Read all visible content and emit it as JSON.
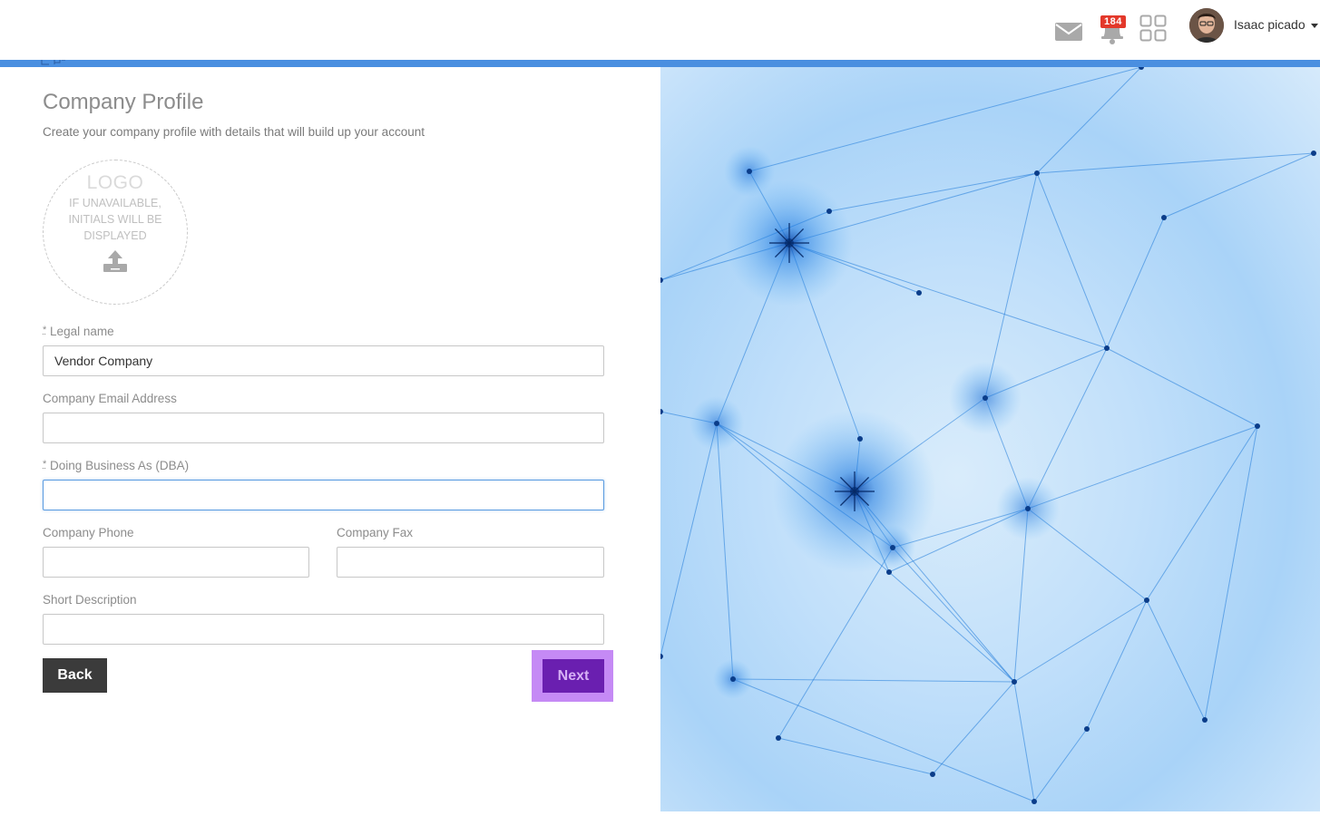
{
  "header": {
    "notification_count": "184",
    "user_name": "Isaac picado",
    "accent_color": "#4a8fe0",
    "badge_color": "#e3382a",
    "icons": [
      "mail-icon",
      "bell-icon",
      "apps-grid-icon",
      "avatar",
      "caret-down-icon"
    ]
  },
  "page": {
    "title": "Company Profile",
    "subtitle": "Create your company profile with details that will build up your account"
  },
  "logo": {
    "title": "LOGO",
    "hint": "IF UNAVAILABLE, INITIALS WILL BE DISPLAYED",
    "icon": "upload-icon"
  },
  "form": {
    "required_mark": "*",
    "legal_name": {
      "label": "Legal name",
      "value": "Vendor Company"
    },
    "email": {
      "label": "Company Email Address",
      "value": ""
    },
    "dba": {
      "label": "Doing Business As (DBA)",
      "value": ""
    },
    "phone": {
      "label": "Company Phone",
      "value": ""
    },
    "fax": {
      "label": "Company Fax",
      "value": ""
    },
    "description": {
      "label": "Short Description",
      "value": ""
    }
  },
  "actions": {
    "back_label": "Back",
    "next_label": "Next",
    "back_color": "#3b3b3b",
    "next_color": "#6a1fb0",
    "next_highlight_color": "#c58af5"
  }
}
